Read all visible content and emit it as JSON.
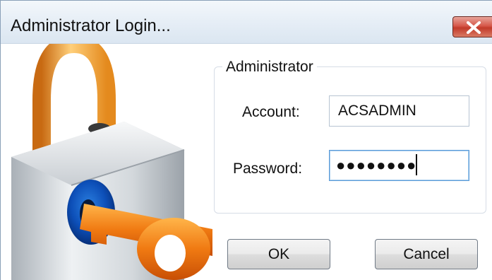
{
  "window": {
    "title": "Administrator Login...",
    "close_icon": "close-icon"
  },
  "group": {
    "legend": "Administrator"
  },
  "fields": {
    "account_label": "Account:",
    "account_value": "ACSADMIN",
    "password_label": "Password:",
    "password_masked": "●●●●●●●●"
  },
  "buttons": {
    "ok_label": "OK",
    "cancel_label": "Cancel"
  },
  "illustration": {
    "icon": "padlock-with-key-icon"
  },
  "colors": {
    "titlebar": "#dbe6f1",
    "close_button": "#c23a2a",
    "focus_border": "#5a9bd8"
  }
}
